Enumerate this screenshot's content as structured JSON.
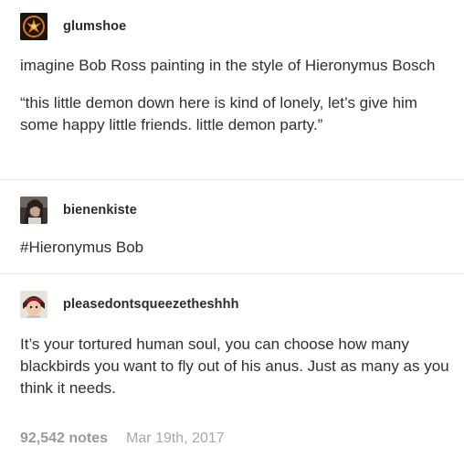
{
  "posts": [
    {
      "username": "glumshoe",
      "avatar_icon": "phoenix-emblem-icon",
      "paragraphs": [
        "imagine Bob Ross painting in the style of Hieronymus Bosch",
        "“this little demon down here is kind of lonely, let’s give him some happy little friends. little demon party.”"
      ]
    },
    {
      "username": "bienenkiste",
      "avatar_icon": "profile-photo-icon",
      "paragraphs": [
        "#Hieronymus Bob"
      ]
    },
    {
      "username": "pleasedontsqueezetheshhh",
      "avatar_icon": "profile-photo-icon",
      "paragraphs": [
        "It’s your tortured human soul, you can choose how many blackbirds you want to fly out of his anus. Just as many as you think it needs."
      ]
    }
  ],
  "footer": {
    "notes": "92,542 notes",
    "date": "Mar 19th, 2017"
  },
  "colors": {
    "text": "#2f2f2f",
    "muted": "#a8a8a8",
    "separator": "#e4e4e4"
  }
}
